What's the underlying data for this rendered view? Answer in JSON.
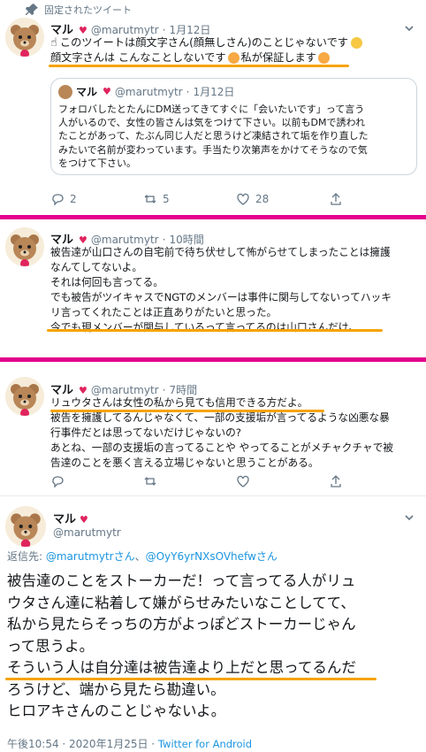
{
  "pinned": {
    "label": "固定されたツイート"
  },
  "tweet1": {
    "name": "マル",
    "heart": "♥",
    "handle": "@marutmytr",
    "time": "1月12日",
    "line1": "このツイートは顔文字さん(顔無しさん)のことじゃないです",
    "line2": "顔文字さんは こんなことしないです",
    "line2b": " 私が保証します",
    "quote": {
      "name": "マル",
      "handle": "@marutmytr",
      "time": "1月12日",
      "lines": [
        "フォロバしたとたんにDM送ってきてすぐに「会いたいです」って言う",
        "人がいるので、女性の皆さんは気をつけて下さい。以前もDMで誘われ",
        "たことがあって、たぶん同じ人だと思うけど凍結されて垢を作り直した",
        "みたいで名前が変わっています。手当たり次第声をかけてそうなので気",
        "をつけて下さい。"
      ]
    },
    "replies": "2",
    "retweets": "5",
    "likes": "28"
  },
  "tweet2": {
    "name": "マル",
    "heart": "♥",
    "handle": "@marutmytr",
    "time": "10時間",
    "lines": [
      "被告達が山口さんの自宅前で待ち伏せして怖がらせてしまったことは擁護",
      "なんてしてないよ。",
      "それは何回も言ってる。",
      "でも被告がツイキャスでNGTのメンバーは事件に関与してないってハッキ",
      "リ言ってくれたことは正直ありがたいと思った。",
      "今でも現メンバーが関与しているって言ってるのは山口さんだけ。"
    ]
  },
  "tweet3": {
    "name": "マル",
    "heart": "♥",
    "handle": "@marutmytr",
    "time": "7時間",
    "lines": [
      "リュウタさんは女性の私から見ても信用できる方だよ。",
      "被告を擁護してるんじゃなくて、一部の支援垢が言ってるような凶悪な暴",
      "行事件だとは思ってないだけじゃないの?",
      "あとね、一部の支援垢の言ってることや やってることがメチャクチャで被",
      "告達のことを悪く言える立場じゃないと思うことがある。"
    ]
  },
  "tweet4": {
    "name": "マル",
    "heart": "♥",
    "handle": "@marutmytr",
    "reply_prefix": "返信先: ",
    "reply_user1": "@marutmytrさん",
    "reply_sep": "、",
    "reply_user2": "@OyY6yrNXsOVhefwさん",
    "lines": [
      "被告達のことをストーカーだ！って言ってる人がリュ",
      "ウタさん達に粘着して嫌がらせみたいなことしてて、",
      "私から見たらそっちの方がよっぽどストーカーじゃん",
      "って思うよ。",
      "そういう人は自分達は被告達より上だと思ってるんだ",
      "ろうけど、端から見たら勘違い。",
      "ヒロアキさんのことじゃないよ。"
    ],
    "timestamp": "午後10:54 · 2020年1月25日 · ",
    "source": "Twitter for Android"
  },
  "colors": {
    "accent": "#1b95e0",
    "highlight": "#f6a300",
    "divider": "#e3008c"
  }
}
